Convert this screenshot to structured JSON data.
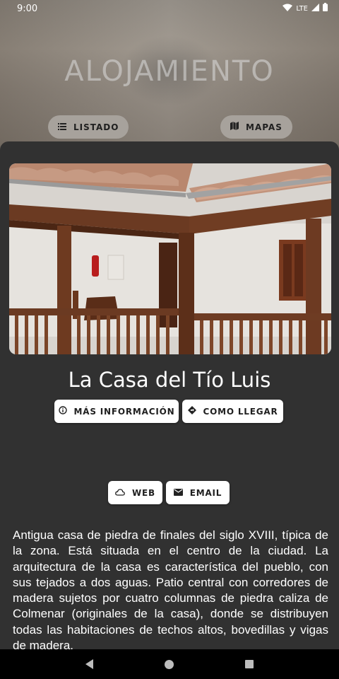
{
  "status_bar": {
    "time": "9:00",
    "network": "LTE"
  },
  "header": {
    "title": "ALOJAMIENTO"
  },
  "nav_buttons": {
    "listado": "LISTADO",
    "mapas": "MAPAS"
  },
  "place": {
    "name": "La Casa del Tío Luis",
    "more_info_label": "MÁS INFORMACIÓN",
    "directions_label": "COMO LLEGAR",
    "web_label": "WEB",
    "email_label": "EMAIL",
    "description": "Antigua casa de piedra de finales del siglo XVIII, típica de la zona. Está situada en el centro de la ciudad. La arquitectura de la casa es característica del pueblo, con sus tejados a dos aguas. Patio central con corredores de madera sujetos por cuatro columnas de piedra caliza de Colmenar (originales de la casa), donde se distribuyen todas las habitaciones de techos altos, bovedillas y vigas de madera."
  },
  "icons": [
    "wifi-icon",
    "signal-icon",
    "battery-icon",
    "list-icon",
    "map-icon",
    "info-icon",
    "directions-icon",
    "cloud-icon",
    "email-icon",
    "back-icon",
    "home-icon",
    "recents-icon"
  ]
}
